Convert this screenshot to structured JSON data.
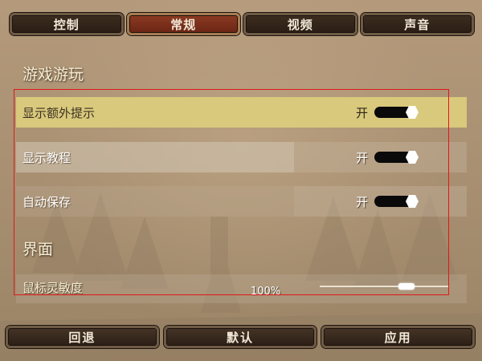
{
  "tabs": [
    {
      "label": "控制",
      "active": false
    },
    {
      "label": "常规",
      "active": true
    },
    {
      "label": "视频",
      "active": false
    },
    {
      "label": "声音",
      "active": false
    }
  ],
  "sections": {
    "gameplay": "游戏游玩",
    "interface": "界面"
  },
  "settings": [
    {
      "label": "显示额外提示",
      "state": "开"
    },
    {
      "label": "显示教程",
      "state": "开"
    },
    {
      "label": "自动保存",
      "state": "开"
    }
  ],
  "mouse_sensitivity": {
    "label": "鼠标灵敏度",
    "value_text": "100%",
    "level": 0.7
  },
  "buttons": {
    "back": "回退",
    "default": "默认",
    "apply": "应用"
  },
  "colors": {
    "highlight": "#d9c97c",
    "selection_box": "#e01818",
    "active_tab": "#8c3a22"
  }
}
